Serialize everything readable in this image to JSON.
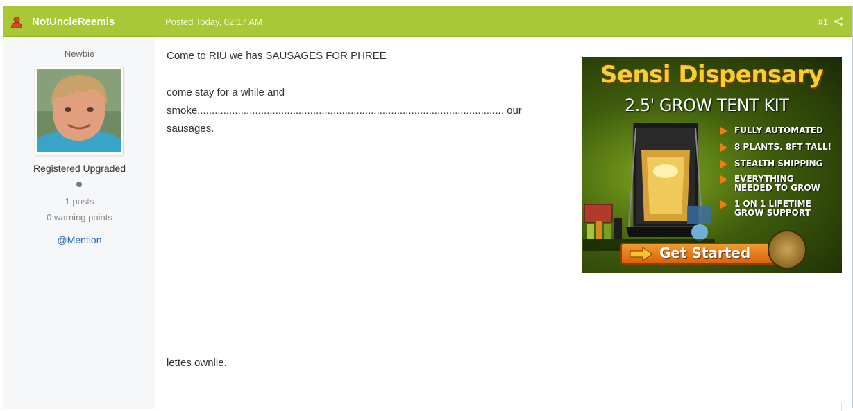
{
  "post": {
    "author": "NotUncleReemis",
    "date": "Posted Today, 02:17 AM",
    "number": "#1",
    "icons": {
      "author": "user-icon",
      "share": "share-icon"
    },
    "colors": {
      "header_bg": "#a8c836",
      "link": "#2e6ba8"
    }
  },
  "author_panel": {
    "rank": "Newbie",
    "group": "Registered Upgraded",
    "posts": "1 posts",
    "warnings": "0 warning points",
    "mention": "@Mention"
  },
  "content": {
    "line1": "Come to RIU we has SAUSAGES FOR PHREE",
    "line2_start": "come stay for a while and smoke",
    "line2_dots": "..........................................................................................................",
    "line2_end": " our sausages.",
    "line3": "lettes ownlie."
  },
  "ad": {
    "title": "Sensi Dispensary",
    "subtitle": "2.5' GROW TENT KIT",
    "bullets": [
      "FULLY AUTOMATED",
      "8 PLANTS. 8FT TALL!",
      "STEALTH SHIPPING",
      "EVERYTHING NEEDED TO GROW",
      "1 ON 1 LIFETIME GROW SUPPORT"
    ],
    "button": "Get Started",
    "colors": {
      "title": "#f3d02a",
      "button": "#e8801c",
      "bullet": "#f07d12"
    }
  }
}
